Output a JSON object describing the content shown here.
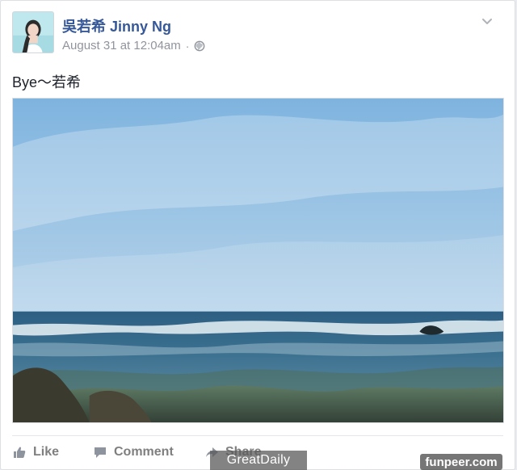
{
  "post": {
    "author_name": "吳若希 Jinny Ng",
    "timestamp": "August 31 at 12:04am",
    "separator": "·",
    "privacy_icon": "globe-icon",
    "status_text": "Bye～若希",
    "menu_icon": "chevron-down-icon"
  },
  "actions": {
    "like_label": "Like",
    "comment_label": "Comment",
    "share_label": "Share"
  },
  "watermarks": {
    "left": "GreatDaily",
    "right": "funpeer.com"
  },
  "colors": {
    "author_link": "#365899",
    "meta_gray": "#90949c",
    "action_gray": "#7f7f7f",
    "border": "#dddfe2"
  }
}
